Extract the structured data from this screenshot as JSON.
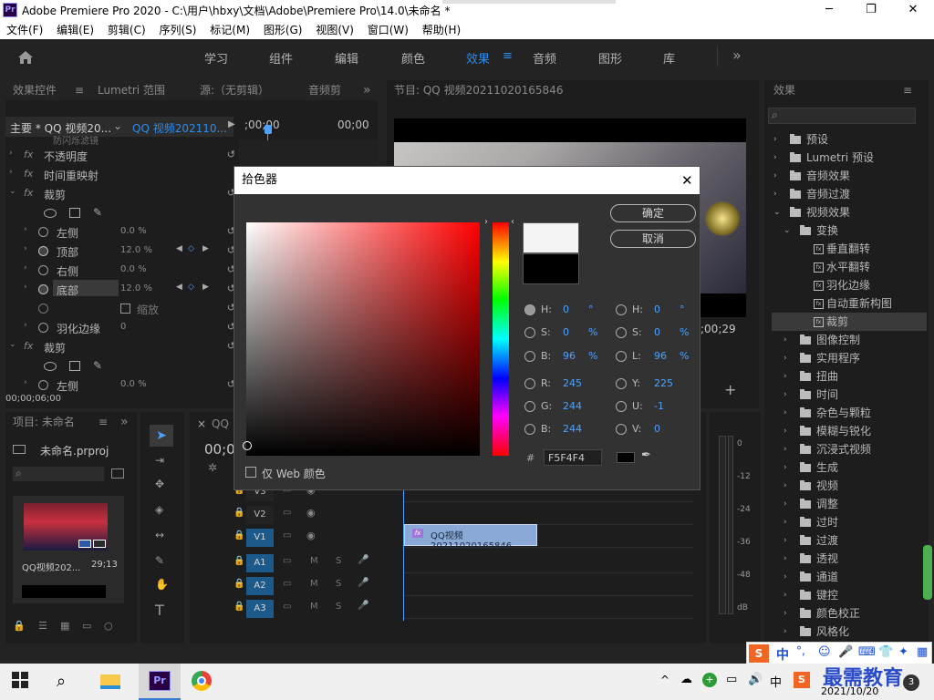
{
  "window": {
    "title": "Adobe Premiere Pro 2020 - C:\\用户\\hbxy\\文档\\Adobe\\Premiere Pro\\14.0\\未命名 *",
    "logo": "Pr"
  },
  "menu": [
    "文件(F)",
    "编辑(E)",
    "剪辑(C)",
    "序列(S)",
    "标记(M)",
    "图形(G)",
    "视图(V)",
    "窗口(W)",
    "帮助(H)"
  ],
  "workspace_tabs": [
    {
      "label": "学习",
      "active": false
    },
    {
      "label": "组件",
      "active": false
    },
    {
      "label": "编辑",
      "active": false
    },
    {
      "label": "颜色",
      "active": false
    },
    {
      "label": "效果",
      "active": true
    },
    {
      "label": "音频",
      "active": false
    },
    {
      "label": "图形",
      "active": false
    },
    {
      "label": "库",
      "active": false
    }
  ],
  "more_glyph": "»",
  "effect_controls": {
    "tabs": [
      "效果控件",
      "Lumetri 范围",
      "源:（无剪辑）",
      "音频剪"
    ],
    "source_label": "主要 * QQ 视频20...",
    "sequence_label": "QQ 视频202110...",
    "time_left": ";00;00",
    "time_right": "00;00",
    "cut_row": "防闪烁滤镜",
    "rows": [
      {
        "label": "不透明度",
        "value": ""
      },
      {
        "label": "时间重映射",
        "value": ""
      },
      {
        "label": "裁剪",
        "value": ""
      },
      {
        "label": "",
        "value": ""
      },
      {
        "label": "左侧",
        "value": "0.0 %"
      },
      {
        "label": "顶部",
        "value": "12.0 %"
      },
      {
        "label": "右侧",
        "value": "0.0 %"
      },
      {
        "label": "底部",
        "value": "12.0 %"
      },
      {
        "label": "缩放",
        "value": ""
      },
      {
        "label": "羽化边缘",
        "value": "0"
      },
      {
        "label": "裁剪",
        "value": ""
      },
      {
        "label": "",
        "value": ""
      },
      {
        "label": "左侧",
        "value": "0.0 %"
      }
    ],
    "timecode": "00;00;06;00"
  },
  "program": {
    "title": "节目: QQ 视频20211020165846",
    "timecode": ";00;29"
  },
  "project": {
    "title": "项目: 未命名",
    "project_file": "未命名.prproj",
    "clip_name": "QQ视频202...",
    "clip_duration": "29;13"
  },
  "timeline": {
    "tab": "QQ",
    "timecode": "00;0",
    "tracks_video": [
      "V3",
      "V2",
      "V1"
    ],
    "tracks_audio": [
      "A1",
      "A2",
      "A3"
    ],
    "mute_label": "M",
    "solo_label": "S",
    "clip_label": "QQ视频20211020165846.",
    "clip_fx": "fx"
  },
  "meter": {
    "labels": [
      "0",
      "-12",
      "-24",
      "-36",
      "-48",
      "dB"
    ]
  },
  "effects_panel": {
    "title": "效果",
    "items": [
      {
        "label": "预设",
        "level": 0,
        "type": "folder"
      },
      {
        "label": "Lumetri 预设",
        "level": 0,
        "type": "folder"
      },
      {
        "label": "音频效果",
        "level": 0,
        "type": "folder"
      },
      {
        "label": "音频过渡",
        "level": 0,
        "type": "folder"
      },
      {
        "label": "视频效果",
        "level": 0,
        "type": "folder"
      },
      {
        "label": "变换",
        "level": 1,
        "type": "folder"
      },
      {
        "label": "垂直翻转",
        "level": 2,
        "type": "fx"
      },
      {
        "label": "水平翻转",
        "level": 2,
        "type": "fx"
      },
      {
        "label": "羽化边缘",
        "level": 2,
        "type": "fx"
      },
      {
        "label": "自动重新构图",
        "level": 2,
        "type": "fx"
      },
      {
        "label": "裁剪",
        "level": 2,
        "type": "fx"
      },
      {
        "label": "图像控制",
        "level": 1,
        "type": "folder"
      },
      {
        "label": "实用程序",
        "level": 1,
        "type": "folder"
      },
      {
        "label": "扭曲",
        "level": 1,
        "type": "folder"
      },
      {
        "label": "时间",
        "level": 1,
        "type": "folder"
      },
      {
        "label": "杂色与颗粒",
        "level": 1,
        "type": "folder"
      },
      {
        "label": "模糊与锐化",
        "level": 1,
        "type": "folder"
      },
      {
        "label": "沉浸式视频",
        "level": 1,
        "type": "folder"
      },
      {
        "label": "生成",
        "level": 1,
        "type": "folder"
      },
      {
        "label": "视频",
        "level": 1,
        "type": "folder"
      },
      {
        "label": "调整",
        "level": 1,
        "type": "folder"
      },
      {
        "label": "过时",
        "level": 1,
        "type": "folder"
      },
      {
        "label": "过渡",
        "level": 1,
        "type": "folder"
      },
      {
        "label": "透视",
        "level": 1,
        "type": "folder"
      },
      {
        "label": "通道",
        "level": 1,
        "type": "folder"
      },
      {
        "label": "键控",
        "level": 1,
        "type": "folder"
      },
      {
        "label": "颜色校正",
        "level": 1,
        "type": "folder"
      },
      {
        "label": "风格化",
        "level": 1,
        "type": "folder"
      }
    ]
  },
  "color_picker": {
    "title": "拾色器",
    "ok": "确定",
    "cancel": "取消",
    "web_only": "仅 Web 颜色",
    "hex_label": "#",
    "hex_value": "F5F4F4",
    "new_color": "#f5f4f4",
    "old_color": "#000000",
    "fields_left": [
      {
        "label": "H:",
        "value": "0",
        "unit": "°",
        "selected": true
      },
      {
        "label": "S:",
        "value": "0",
        "unit": "%",
        "selected": false
      },
      {
        "label": "B:",
        "value": "96",
        "unit": "%",
        "selected": false
      },
      {
        "label": "R:",
        "value": "245",
        "unit": "",
        "selected": false
      },
      {
        "label": "G:",
        "value": "244",
        "unit": "",
        "selected": false
      },
      {
        "label": "B:",
        "value": "244",
        "unit": "",
        "selected": false
      }
    ],
    "fields_right": [
      {
        "label": "H:",
        "value": "0",
        "unit": "°"
      },
      {
        "label": "S:",
        "value": "0",
        "unit": "%"
      },
      {
        "label": "L:",
        "value": "96",
        "unit": "%"
      },
      {
        "label": "Y:",
        "value": "225",
        "unit": ""
      },
      {
        "label": "U:",
        "value": "-1",
        "unit": ""
      },
      {
        "label": "V:",
        "value": "0",
        "unit": ""
      }
    ]
  },
  "ime": {
    "label": "中",
    "watermark": "最需教育",
    "dot": "°,"
  },
  "taskbar": {
    "date": "2021/10/20",
    "tray_lang": "中",
    "notify_count": "3",
    "time": ""
  },
  "colors": {
    "accent": "#2d8ceb",
    "track_active": "#1b5a8a",
    "clip": "#8aa9d6",
    "marker": "#4ea2ff"
  }
}
